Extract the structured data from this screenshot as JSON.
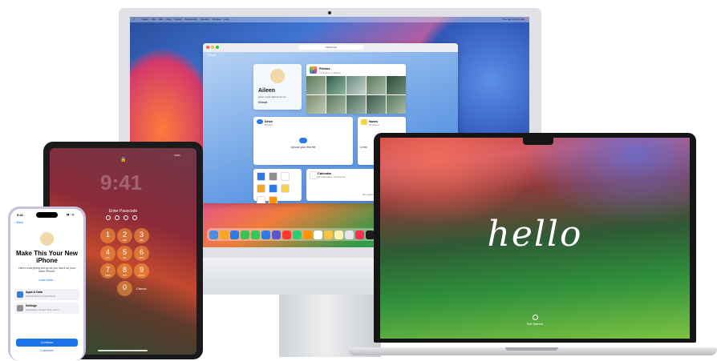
{
  "imac": {
    "menubar_items": [
      "Safari",
      "File",
      "Edit",
      "View",
      "History",
      "Bookmarks",
      "Develop",
      "Window",
      "Help"
    ],
    "menubar_clock": "Tue Sep 12 9:41 AM",
    "browser": {
      "url": "icloud.com",
      "brand": "iCloud",
      "profile": {
        "name": "Aileen",
        "email": "aileen.zeigen@icloud.com",
        "service": "iCloud"
      },
      "photos": {
        "title": "Photos",
        "subtitle": "71 Photos, 3 Videos"
      },
      "drive": {
        "title": "Drive",
        "subtitle": "Browse",
        "upload_label": "Upload your first file"
      },
      "notes": {
        "title": "Notes",
        "subtitle": "All iCloud",
        "text": "Creat"
      },
      "calendar": {
        "title": "Calendar",
        "subtitle": "All Calendars - No Events",
        "empty_text": "No events scheduled for today."
      },
      "app_tiles": [
        "Mail",
        "Contacts",
        "Calendar",
        "Photos",
        "Drive",
        "Notes",
        "Reminders",
        "Pages"
      ]
    },
    "dock_colors": [
      "#4a90e2",
      "#f5a623",
      "#2c7be5",
      "#3fc255",
      "#34c759",
      "#2c7be5",
      "#5856d6",
      "#ff3b30",
      "#2ecc71",
      "#ff9500",
      "#ffffff",
      "#f4c542",
      "#fff4b0",
      "#e5e5ea",
      "#ff2d55",
      "#1c1c1e",
      "#0a84ff",
      "#bf5af2",
      "#ff3b30",
      "#2c2c2e"
    ]
  },
  "ipad": {
    "time": "9:41",
    "status": "100%",
    "prompt": "Enter Passcode",
    "keys": [
      {
        "n": "1",
        "l": ""
      },
      {
        "n": "2",
        "l": "ABC"
      },
      {
        "n": "3",
        "l": "DEF"
      },
      {
        "n": "4",
        "l": "GHI"
      },
      {
        "n": "5",
        "l": "JKL"
      },
      {
        "n": "6",
        "l": "MNO"
      },
      {
        "n": "7",
        "l": "PQRS"
      },
      {
        "n": "8",
        "l": "TUV"
      },
      {
        "n": "9",
        "l": "WXYZ"
      },
      {
        "n": "0",
        "l": ""
      }
    ],
    "cancel": "Cancel"
  },
  "iphone": {
    "time": "9:41",
    "back": "Back",
    "title": "Make This Your New iPhone",
    "description": "Here's everything set up as you had it on your other iPhone.",
    "learn_more": "Learn More...",
    "rows": [
      {
        "title": "Apps & Data",
        "subtitle": "Transfer Directly From iPhone"
      },
      {
        "title": "Settings",
        "subtitle": "Appearance, Screen Time, and m..."
      }
    ],
    "continue": "Continue",
    "customize": "Customize"
  },
  "macbook": {
    "greeting": "hello",
    "get_started": "Get Started"
  }
}
